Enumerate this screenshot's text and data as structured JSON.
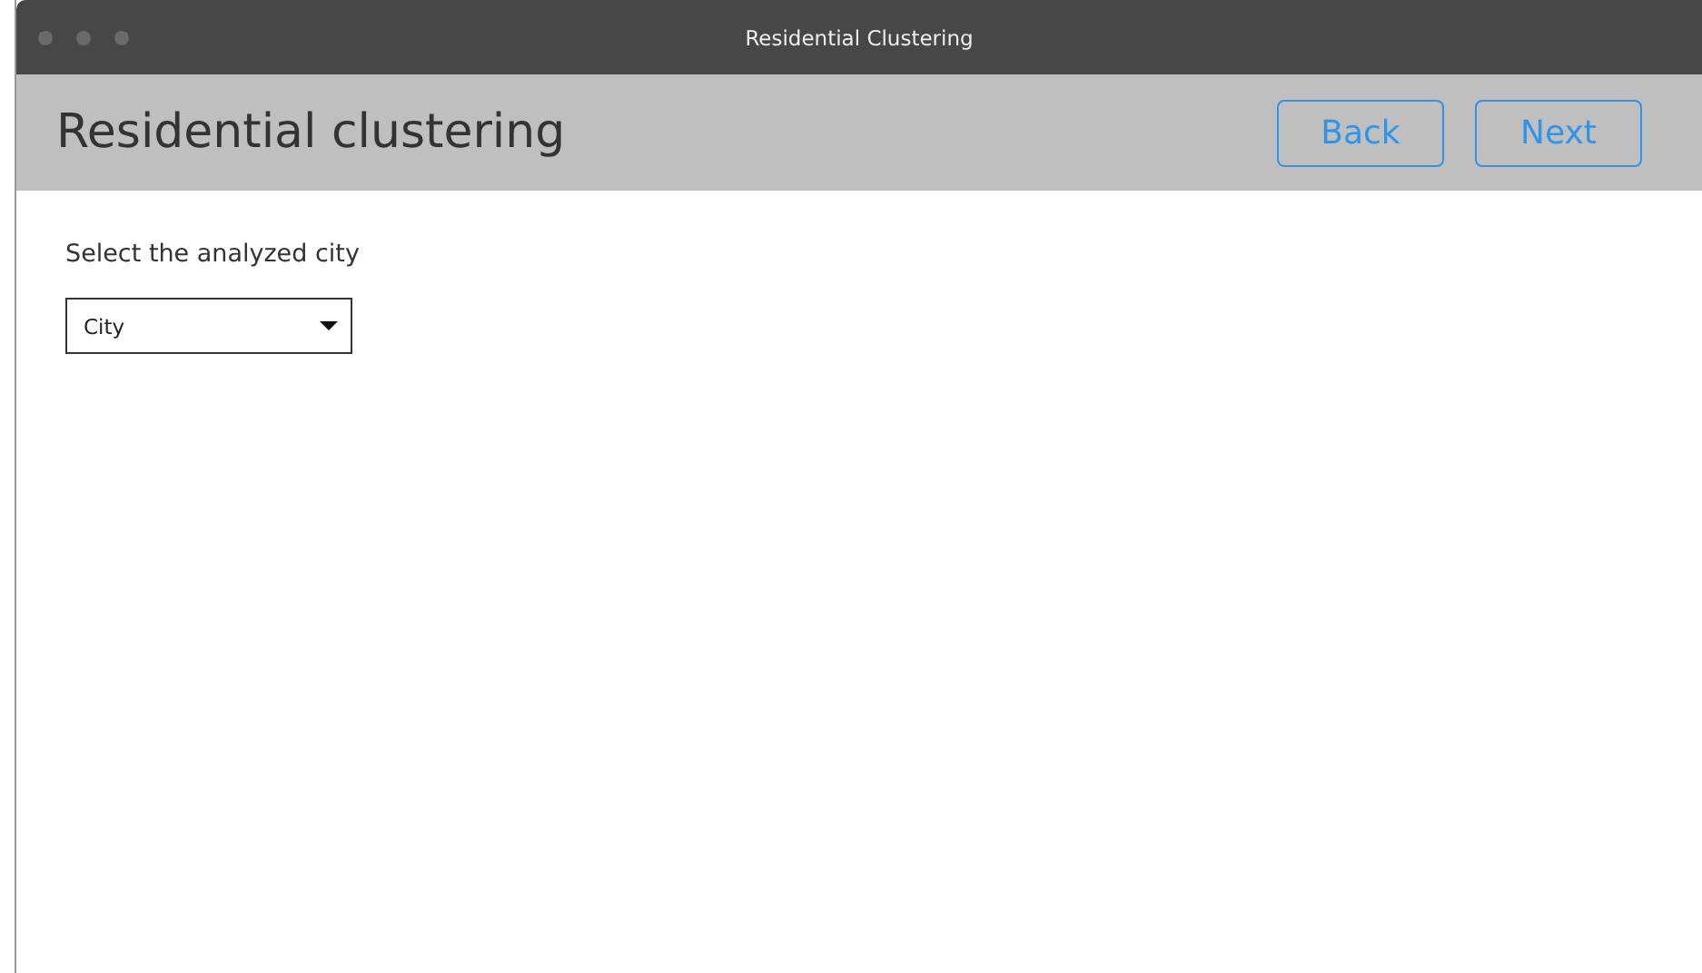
{
  "window": {
    "title": "Residential Clustering"
  },
  "header": {
    "title": "Residential clustering",
    "buttons": [
      {
        "label": "Back"
      },
      {
        "label": "Next"
      }
    ]
  },
  "form": {
    "label": "Select the analyzed city",
    "dropdown": {
      "value": "City"
    }
  }
}
